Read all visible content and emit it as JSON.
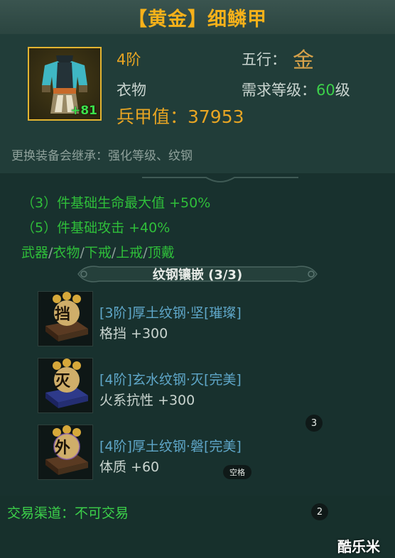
{
  "item": {
    "title": "【黄金】细鳞甲",
    "plus": "+81",
    "grade": "4阶",
    "slot": "衣物",
    "element_label": "五行：",
    "element_value": "金",
    "req_label": "需求等级：",
    "req_level": "60",
    "req_unit": "级",
    "power": "兵甲值：37953",
    "inherit_note": "更换装备会继承：强化等级、纹钢"
  },
  "set_bonus": {
    "lines": [
      "（3）件基础生命最大值  +50%",
      "（5）件基础攻击  +40%"
    ],
    "parts": [
      "武器",
      "衣物",
      "下戒",
      "上戒",
      "顶戴"
    ],
    "separator": "/"
  },
  "embed": {
    "header": "纹钢镶嵌 (3/3)",
    "gems": [
      {
        "char": "挡",
        "name": "[3阶]厚土纹钢·坚[璀璨]",
        "stat": "格挡   +300",
        "icon": "earth-gem-icon"
      },
      {
        "char": "灭",
        "name": "[4阶]玄水纹钢·灭[完美]",
        "stat": "火系抗性   +300",
        "icon": "water-gem-icon"
      },
      {
        "char": "外",
        "name": "[4阶]厚土纹钢·磐[完美]",
        "stat": "体质   +60",
        "icon": "earth-gem-icon"
      }
    ]
  },
  "overlays": {
    "badge_3": "3",
    "space_tag": "空格",
    "badge_2": "2"
  },
  "trade": "交易渠道：不可交易",
  "watermark": "酷乐米",
  "colors": {
    "gold_title": "#f6b11a",
    "set_green": "#2fbf3a",
    "gem_name_blue": "#5fa7c9",
    "level_green": "#3cd04a"
  }
}
